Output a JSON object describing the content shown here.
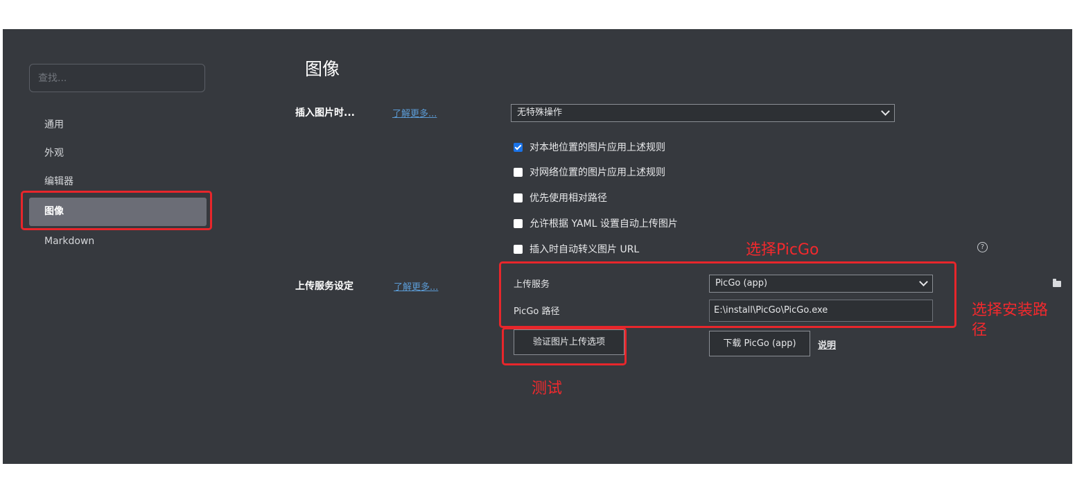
{
  "sidebar": {
    "search_placeholder": "查找...",
    "items": [
      {
        "label": "通用"
      },
      {
        "label": "外观"
      },
      {
        "label": "编辑器"
      },
      {
        "label": "图像"
      },
      {
        "label": "Markdown"
      }
    ]
  },
  "main": {
    "title": "图像",
    "insert": {
      "label": "插入图片时...",
      "learn_more": "了解更多...",
      "select_value": "无特殊操作",
      "options": [
        {
          "label": "对本地位置的图片应用上述规则",
          "checked": true
        },
        {
          "label": "对网络位置的图片应用上述规则",
          "checked": false
        },
        {
          "label": "优先使用相对路径",
          "checked": false
        },
        {
          "label": "允许根据 YAML 设置自动上传图片",
          "checked": false
        },
        {
          "label": "插入时自动转义图片 URL",
          "checked": false
        }
      ]
    },
    "upload": {
      "label": "上传服务设定",
      "learn_more": "了解更多...",
      "service_label": "上传服务",
      "service_value": "PicGo (app)",
      "path_label": "PicGo 路径",
      "path_value": "E:\\install\\PicGo\\PicGo.exe",
      "verify_button": "验证图片上传选项",
      "download_button": "下载 PicGo (app)",
      "explain_link": "说明"
    }
  },
  "annotations": {
    "select_picgo": "选择PicGo",
    "select_path": "选择安装路\n径",
    "test": "测试"
  },
  "colors": {
    "panel_bg": "#36393e",
    "highlight_red": "#e8262b",
    "active_item_bg": "#6b6d76",
    "link_blue": "#5b9bd5",
    "checkbox_blue": "#1a73e8"
  }
}
